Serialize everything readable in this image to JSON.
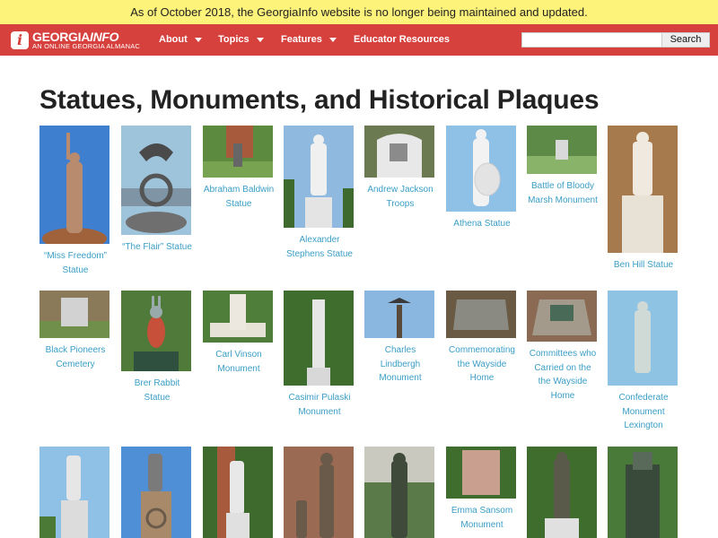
{
  "notice": "As of October 2018, the GeorgiaInfo website is no longer being maintained and updated.",
  "logo": {
    "name_regular": "GEORGIA",
    "name_bold": "INFO",
    "tagline": "AN ONLINE GEORGIA ALMANAC",
    "glyph": "i"
  },
  "nav": {
    "about": "About",
    "topics": "Topics",
    "features": "Features",
    "educator": "Educator Resources"
  },
  "search": {
    "value": "",
    "placeholder": "",
    "button": "Search"
  },
  "page_title": "Statues, Monuments, and Historical Plaques",
  "colors": {
    "nav_bg": "#d6403d",
    "notice_bg": "#fdf27a",
    "link": "#3a9ec6"
  },
  "tiles": [
    {
      "caption": "“Miss Freedom” Statue"
    },
    {
      "caption": "“The Flair” Statue"
    },
    {
      "caption": "Abraham Baldwin Statue"
    },
    {
      "caption": "Alexander Stephens Statue"
    },
    {
      "caption": "Andrew Jackson Troops"
    },
    {
      "caption": "Athena Statue"
    },
    {
      "caption": "Battle of Bloody Marsh Monument"
    },
    {
      "caption": "Ben Hill Statue"
    },
    {
      "caption": "Black Pioneers Cemetery"
    },
    {
      "caption": "Brer Rabbit Statue"
    },
    {
      "caption": "Carl Vinson Monument"
    },
    {
      "caption": "Casimir Pulaski Monument"
    },
    {
      "caption": "Charles Lindbergh Monument"
    },
    {
      "caption": "Commemorating the Wayside Home"
    },
    {
      "caption": "Committees who Carried on the the Wayside Home"
    },
    {
      "caption": "Confederate Monument Lexington"
    },
    {
      "caption": ""
    },
    {
      "caption": ""
    },
    {
      "caption": ""
    },
    {
      "caption": ""
    },
    {
      "caption": ""
    },
    {
      "caption": "Emma Sansom Monument"
    },
    {
      "caption": ""
    },
    {
      "caption": ""
    }
  ]
}
